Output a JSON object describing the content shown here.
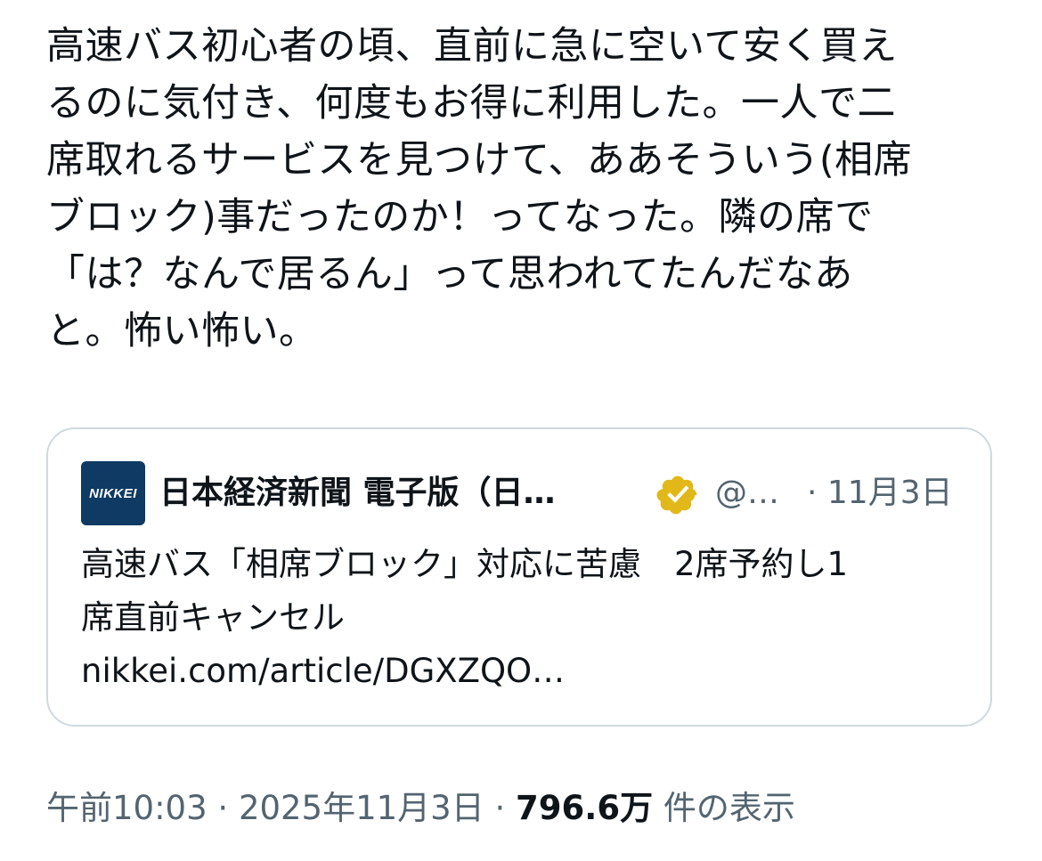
{
  "tweet": {
    "text_lines": [
      "高速バス初心者の頃、直前に急に空いて安く買え",
      "るのに気付き、何度もお得に利用した。一人で二",
      "席取れるサービスを見つけて、ああそういう(相席",
      "ブロック)事だったのか！ってなった。隣の席で",
      "「は？なんで居るん」って思われてたんだなあ",
      "と。怖い怖い。"
    ],
    "time": "午前10:03",
    "date": "2025年11月3日",
    "views_count": "796.6万",
    "views_label": "件の表示",
    "separator": "·"
  },
  "quote": {
    "avatar_text": "NIKKEI",
    "avatar_color": "#0e3a63",
    "author_name": "日本経済新聞 電子版（日…",
    "verified_icon": "verified-gold-badge",
    "handle": "@…",
    "date": "· 11月3日",
    "body_lines": [
      "高速バス「相席ブロック」対応に苦慮　2席予約し1",
      "席直前キャンセル"
    ],
    "link_text": "nikkei.com/article/DGXZQO…"
  },
  "colors": {
    "text_primary": "#0f1419",
    "text_secondary": "#536471",
    "border": "#cfd9de",
    "verified_gold": "#e2b719"
  }
}
